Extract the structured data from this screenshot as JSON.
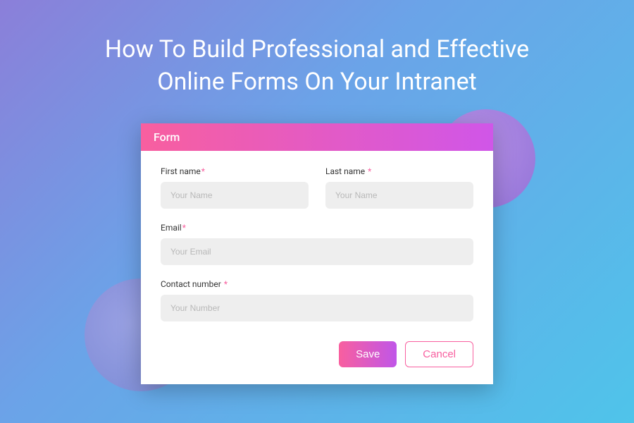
{
  "page": {
    "title_line1": "How To Build Professional and Effective",
    "title_line2": "Online Forms On Your Intranet"
  },
  "form": {
    "header": "Form",
    "fields": {
      "first_name": {
        "label": "First name",
        "placeholder": "Your Name",
        "value": ""
      },
      "last_name": {
        "label": "Last name",
        "placeholder": "Your Name",
        "value": ""
      },
      "email": {
        "label": "Email",
        "placeholder": "Your Email",
        "value": ""
      },
      "contact_number": {
        "label": "Contact number",
        "placeholder": "Your Number",
        "value": ""
      }
    },
    "required_marker": "*",
    "actions": {
      "save": "Save",
      "cancel": "Cancel"
    }
  }
}
